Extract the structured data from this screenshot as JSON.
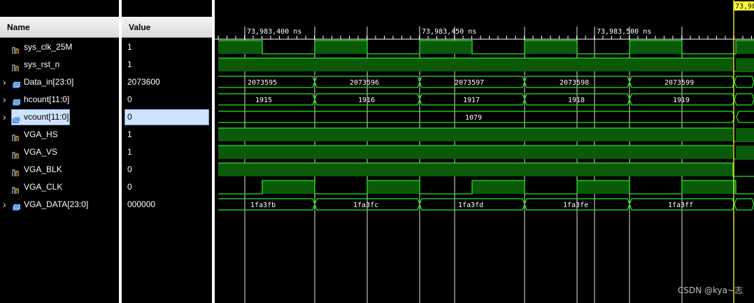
{
  "headers": {
    "name": "Name",
    "value": "Value"
  },
  "signals": [
    {
      "name": "sys_clk_25M",
      "value": "1",
      "expandable": false,
      "icon": "signal-icon",
      "selected": false
    },
    {
      "name": "sys_rst_n",
      "value": "1",
      "expandable": false,
      "icon": "signal-icon",
      "selected": false
    },
    {
      "name": "Data_in[23:0]",
      "value": "2073600",
      "expandable": true,
      "icon": "bus-icon",
      "selected": false
    },
    {
      "name": "hcount[11:0]",
      "value": "0",
      "expandable": true,
      "icon": "bus-icon",
      "selected": false
    },
    {
      "name": "vcount[11:0]",
      "value": "0",
      "expandable": true,
      "icon": "bus-icon",
      "selected": true
    },
    {
      "name": "VGA_HS",
      "value": "1",
      "expandable": false,
      "icon": "signal-icon",
      "selected": false
    },
    {
      "name": "VGA_VS",
      "value": "1",
      "expandable": false,
      "icon": "signal-icon",
      "selected": false
    },
    {
      "name": "VGA_BLK",
      "value": "0",
      "expandable": false,
      "icon": "signal-icon",
      "selected": false
    },
    {
      "name": "VGA_CLK",
      "value": "0",
      "expandable": false,
      "icon": "signal-icon",
      "selected": false
    },
    {
      "name": "VGA_DATA[23:0]",
      "value": "000000",
      "expandable": true,
      "icon": "bus-icon",
      "selected": false
    }
  ],
  "timeline": {
    "labels": [
      "73,983,400 ns",
      "73,983,450 ns",
      "73,983,500 ns"
    ],
    "cursor_label": "73,98"
  },
  "waves": {
    "data_in": [
      "2073595",
      "2073596",
      "2073597",
      "2073598",
      "2073599"
    ],
    "hcount": [
      "1915",
      "1916",
      "1917",
      "1918",
      "1919"
    ],
    "vcount": [
      "1079"
    ],
    "vga_data": [
      "1fa3fb",
      "1fa3fc",
      "1fa3fd",
      "1fa3fe",
      "1fa3ff"
    ]
  },
  "colors": {
    "wave": "#22e822",
    "wave_fill": "#0a5a0a",
    "cursor": "#ffff33",
    "selection": "#cfe3ff"
  },
  "watermark": "CSDN @kya~志"
}
